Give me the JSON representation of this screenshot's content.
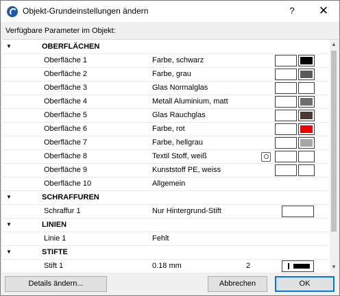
{
  "window": {
    "title": "Objekt-Grundeinstellungen ändern",
    "help_label": "?",
    "close_label": "✕"
  },
  "subtitle": "Verfügbare Parameter im Objekt:",
  "sections": {
    "oberflaechen": {
      "label": "OBERFLÄCHEN",
      "arrow": "▼"
    },
    "schraffuren": {
      "label": "SCHRAFFUREN",
      "arrow": "▼"
    },
    "linien": {
      "label": "LINIEN",
      "arrow": "▼"
    },
    "stifte": {
      "label": "STIFTE",
      "arrow": "▼"
    }
  },
  "surfaces": [
    {
      "name": "Oberfläche 1",
      "value": "Farbe, schwarz",
      "color": "#000000"
    },
    {
      "name": "Oberfläche 2",
      "value": "Farbe, grau",
      "color": "#5a5a5a"
    },
    {
      "name": "Oberfläche 3",
      "value": "Glas Normalglas",
      "color": "#ffffff"
    },
    {
      "name": "Oberfläche 4",
      "value": "Metall Aluminium, matt",
      "color": "#6e6e6e"
    },
    {
      "name": "Oberfläche 5",
      "value": "Glas Rauchglas",
      "color": "#4a3a32"
    },
    {
      "name": "Oberfläche 6",
      "value": "Farbe, rot",
      "color": "#ee0000"
    },
    {
      "name": "Oberfläche 7",
      "value": "Farbe, hellgrau",
      "color": "#a6a6a6"
    },
    {
      "name": "Oberfläche 8",
      "value": "Textil Stoff, weiß",
      "color": "#ffffff"
    },
    {
      "name": "Oberfläche 9",
      "value": "Kunststoff PE, weiss",
      "color": "#ffffff"
    },
    {
      "name": "Oberfläche 10",
      "value": "Allgemein"
    }
  ],
  "hatch": {
    "name": "Schraffur 1",
    "value": "Nur Hintergrund-Stift"
  },
  "line": {
    "name": "Linie 1",
    "value": "Fehlt"
  },
  "pen": {
    "name": "Stift 1",
    "value": "0.18 mm",
    "number": "2"
  },
  "buttons": {
    "details": "Details ändern...",
    "cancel": "Abbrechen",
    "ok": "OK"
  },
  "scroll": {
    "arrow_up": "▲",
    "arrow_down": "▼"
  }
}
